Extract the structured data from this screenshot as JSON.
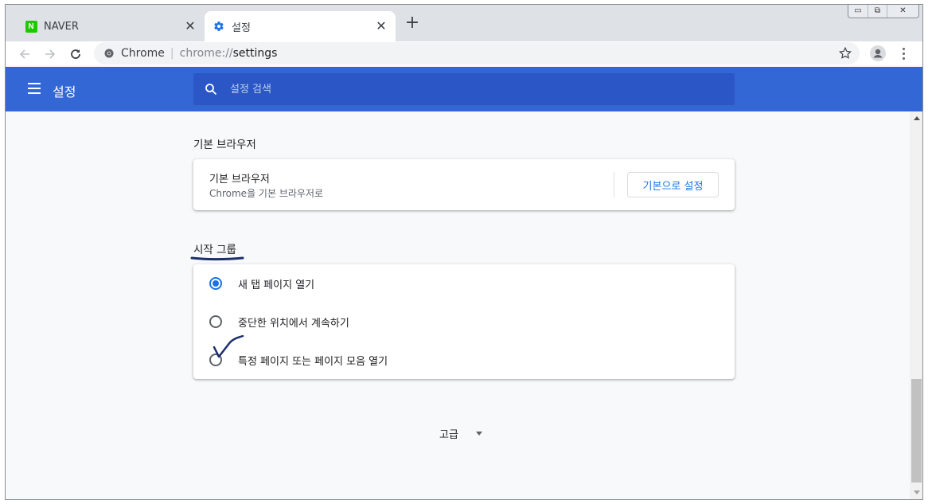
{
  "tabs": [
    {
      "title": "NAVER",
      "favicon_letter": "N"
    },
    {
      "title": "설정",
      "active": true
    }
  ],
  "toolbar": {
    "omnibox_site": "Chrome",
    "omnibox_sep": "|",
    "omnibox_scheme": "chrome://",
    "omnibox_path": "settings"
  },
  "header": {
    "title": "설정",
    "search_placeholder": "설정 검색"
  },
  "default_browser": {
    "section_title": "기본 브라우저",
    "label": "기본 브라우저",
    "sublabel": "Chrome을 기본 브라우저로",
    "button": "기본으로 설정"
  },
  "startup": {
    "section_title": "시작 그룹",
    "options": [
      {
        "label": "새 탭 페이지 열기",
        "selected": true
      },
      {
        "label": "중단한 위치에서 계속하기",
        "selected": false
      },
      {
        "label": "특정 페이지 또는 페이지 모음 열기",
        "selected": false
      }
    ]
  },
  "advanced": {
    "label": "고급"
  },
  "colors": {
    "header_blue": "#3367d6",
    "search_blue": "#2a56c6",
    "accent": "#1a73e8",
    "annotation_ink": "#1b2f6b"
  },
  "icons": [
    "naver-icon",
    "gear-icon",
    "close-icon",
    "plus-icon",
    "back-icon",
    "forward-icon",
    "reload-icon",
    "chrome-icon",
    "star-icon",
    "profile-icon",
    "more-icon",
    "menu-icon",
    "search-icon",
    "dropdown-arrow-icon"
  ]
}
